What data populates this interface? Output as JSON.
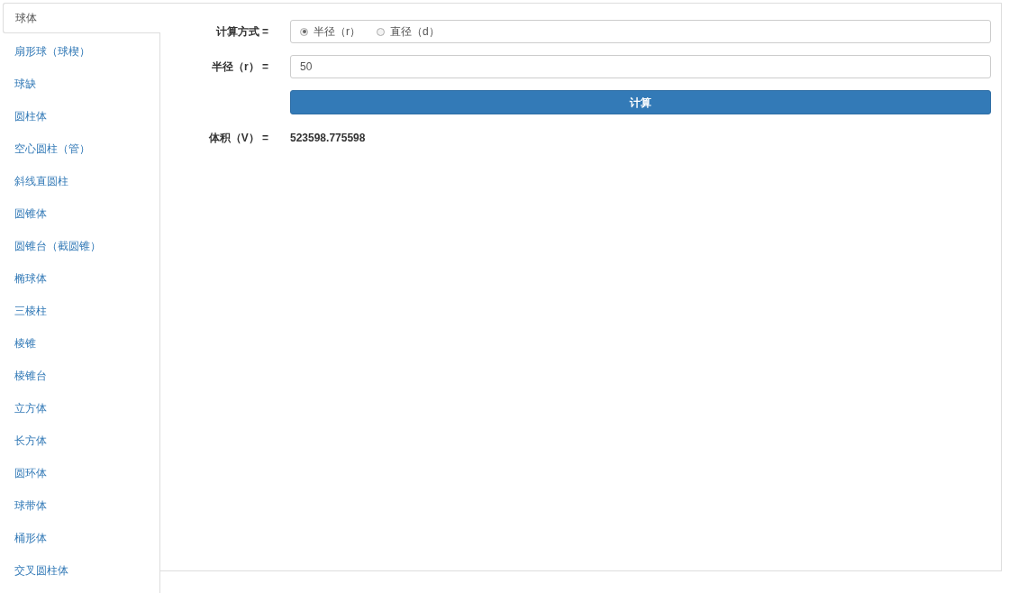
{
  "tabs": [
    {
      "label": "球体",
      "selected": true
    },
    {
      "label": "扇形球（球楔）",
      "selected": false
    },
    {
      "label": "球缺",
      "selected": false
    },
    {
      "label": "圆柱体",
      "selected": false
    },
    {
      "label": "空心圆柱（管）",
      "selected": false
    },
    {
      "label": "斜线直圆柱",
      "selected": false
    },
    {
      "label": "圆锥体",
      "selected": false
    },
    {
      "label": "圆锥台（截圆锥）",
      "selected": false
    },
    {
      "label": "椭球体",
      "selected": false
    },
    {
      "label": "三棱柱",
      "selected": false
    },
    {
      "label": "棱锥",
      "selected": false
    },
    {
      "label": "棱锥台",
      "selected": false
    },
    {
      "label": "立方体",
      "selected": false
    },
    {
      "label": "长方体",
      "selected": false
    },
    {
      "label": "圆环体",
      "selected": false
    },
    {
      "label": "球带体",
      "selected": false
    },
    {
      "label": "桶形体",
      "selected": false
    },
    {
      "label": "交叉圆柱体",
      "selected": false
    }
  ],
  "form": {
    "method_label": "计算方式 =",
    "method_options": [
      {
        "label": "半径（r）",
        "selected": true
      },
      {
        "label": "直径（d）",
        "selected": false
      }
    ],
    "radius_label": "半径（r） =",
    "radius_value": "50",
    "button": "计算",
    "result_label": "体积（V） =",
    "result_value": "523598.775598"
  }
}
